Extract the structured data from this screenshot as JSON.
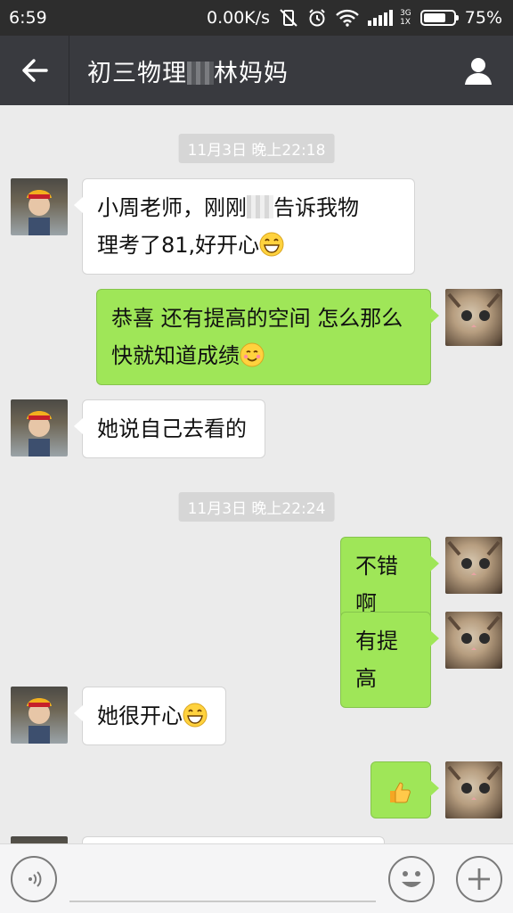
{
  "status_bar": {
    "time": "6:59",
    "net_speed": "0.00K/s",
    "net_type_top": "3G",
    "net_type_bottom": "1X",
    "battery": "75%",
    "battery_level": 0.75
  },
  "header": {
    "title_prefix": "初三物理",
    "title_suffix": "林妈妈"
  },
  "messages": [
    {
      "type": "timestamp",
      "text": "11月3日 晚上22:18"
    },
    {
      "type": "in",
      "parts": [
        "小周老师，刚刚",
        "告诉我物",
        "理考了81,好开心"
      ],
      "emoji": "grin"
    },
    {
      "type": "out",
      "lines": [
        "恭喜 还有提高的空间 怎么那么",
        "快就知道成绩"
      ],
      "emoji": "smile"
    },
    {
      "type": "in",
      "text": "她说自己去看的"
    },
    {
      "type": "timestamp",
      "text": "11月3日 晚上22:24"
    },
    {
      "type": "out",
      "text": "不错啊"
    },
    {
      "type": "out",
      "text": "有提高"
    },
    {
      "type": "in",
      "text": "她很开心",
      "emoji": "grin"
    },
    {
      "type": "out",
      "emoji": "thumbs-up"
    }
  ]
}
